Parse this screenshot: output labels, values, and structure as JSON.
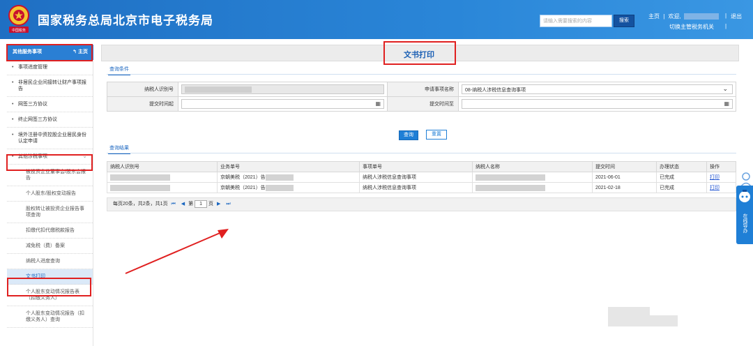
{
  "header": {
    "title": "国家税务总局北京市电子税务局",
    "search_placeholder": "请输入需要搜索的内容",
    "search_button": "搜索",
    "home_link": "主页",
    "welcome": "欢迎,",
    "switch_org": "切换主管税务机关",
    "logout": "退出",
    "emblem_text": "中国税务"
  },
  "sidebar": {
    "head": "其他服务事项",
    "home": "主页",
    "items": [
      {
        "label": "事项进度管理"
      },
      {
        "label": "非居民企业间接转让财产事项报告"
      },
      {
        "label": "网签三方协议"
      },
      {
        "label": "终止网签三方协议"
      },
      {
        "label": "境外注册中资控股企业居民身份认定申请"
      },
      {
        "label": "其他涉税事项"
      }
    ],
    "sub_items": [
      {
        "label": "被投资企业董事会/股东会报告"
      },
      {
        "label": "个人股东/股权变动报告"
      },
      {
        "label": "股权转让被投资企业报告事项查询"
      },
      {
        "label": "扣缴代扣代缴税款报告"
      },
      {
        "label": "减免税（费）备案"
      },
      {
        "label": "纳税人进度查询"
      },
      {
        "label": "文书打印"
      },
      {
        "label": "个人股东变动情况报告表（扣缴义务人）"
      },
      {
        "label": "个人股东变动情况报告（扣缴义务人）查询"
      }
    ]
  },
  "main": {
    "page_title": "文书打印",
    "query_tab": "查询条件",
    "result_tab": "查询结果",
    "form": {
      "taxpayer_id_label": "纳税人识别号",
      "item_name_label": "申请事项名称",
      "item_name_value": "08-纳税人涉税信息查询事项",
      "submit_from_label": "提交时间起",
      "submit_to_label": "提交时间至"
    },
    "buttons": {
      "query": "查询",
      "reset": "重置"
    },
    "columns": [
      "纳税人识别号",
      "业务单号",
      "事项单号",
      "纳税人名称",
      "提交时间",
      "办理状态",
      "操作"
    ],
    "rows": [
      {
        "biz_no": "京朝美税（2021）告",
        "item_no": "纳税人涉税信息查询事项",
        "submit_time": "2021-06-01",
        "status": "已完成",
        "action": "打印"
      },
      {
        "biz_no": "京朝美税（2021）告",
        "item_no": "纳税人涉税信息查询事项",
        "submit_time": "2021-02-18",
        "status": "已完成",
        "action": "打印"
      }
    ],
    "pager": {
      "summary": "每页20条，共2条，共1页",
      "page_prefix": "第",
      "page_value": "1",
      "page_suffix": "页"
    }
  },
  "widget": {
    "label": "在线导办"
  }
}
